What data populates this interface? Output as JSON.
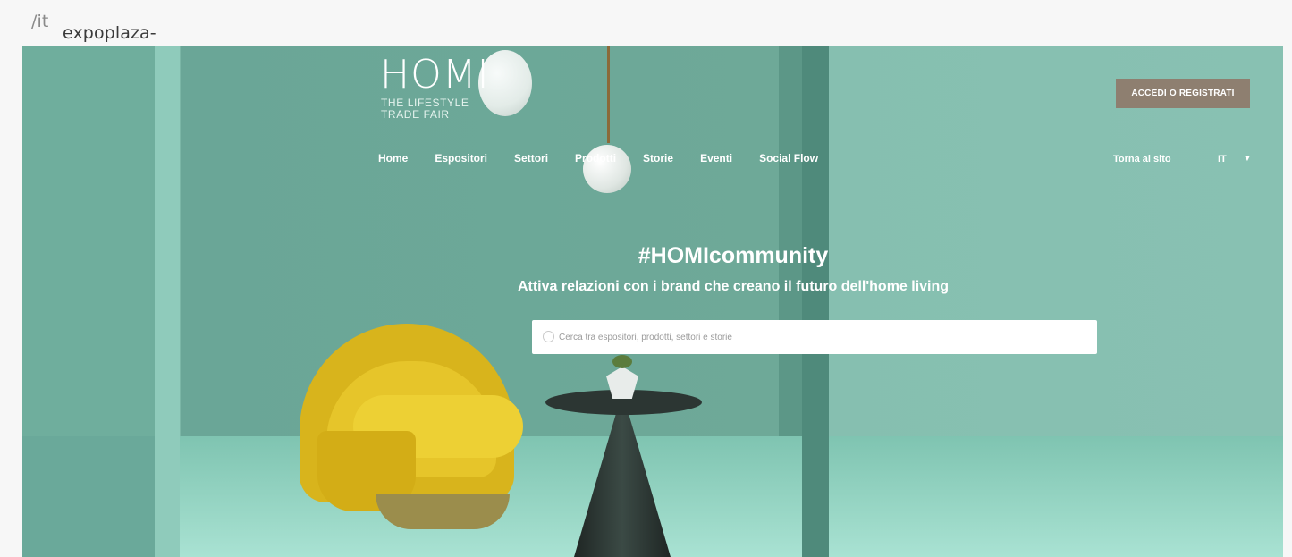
{
  "browser": {
    "url_host": "expoplaza-homi.fieramilano.it",
    "url_path": "/it"
  },
  "logo": {
    "name": "HOMI",
    "tagline_line1": "THE LIFESTYLE",
    "tagline_line2": "TRADE FAIR"
  },
  "nav": {
    "items": [
      "Home",
      "Espositori",
      "Settori",
      "Prodotti",
      "Storie",
      "Eventi",
      "Social Flow"
    ]
  },
  "header": {
    "login_label": "ACCEDI O REGISTRATI",
    "back_label": "Torna al sito",
    "language": "IT"
  },
  "hero": {
    "title": "#HOMIcommunity",
    "subtitle": "Attiva relazioni con i brand che creano il futuro dell'home living",
    "search_placeholder": "Cerca tra espositori, prodotti, settori e storie"
  },
  "colors": {
    "wall": "#6ea998",
    "login_button": "#8e7f70",
    "chair": "#e6c52a"
  }
}
